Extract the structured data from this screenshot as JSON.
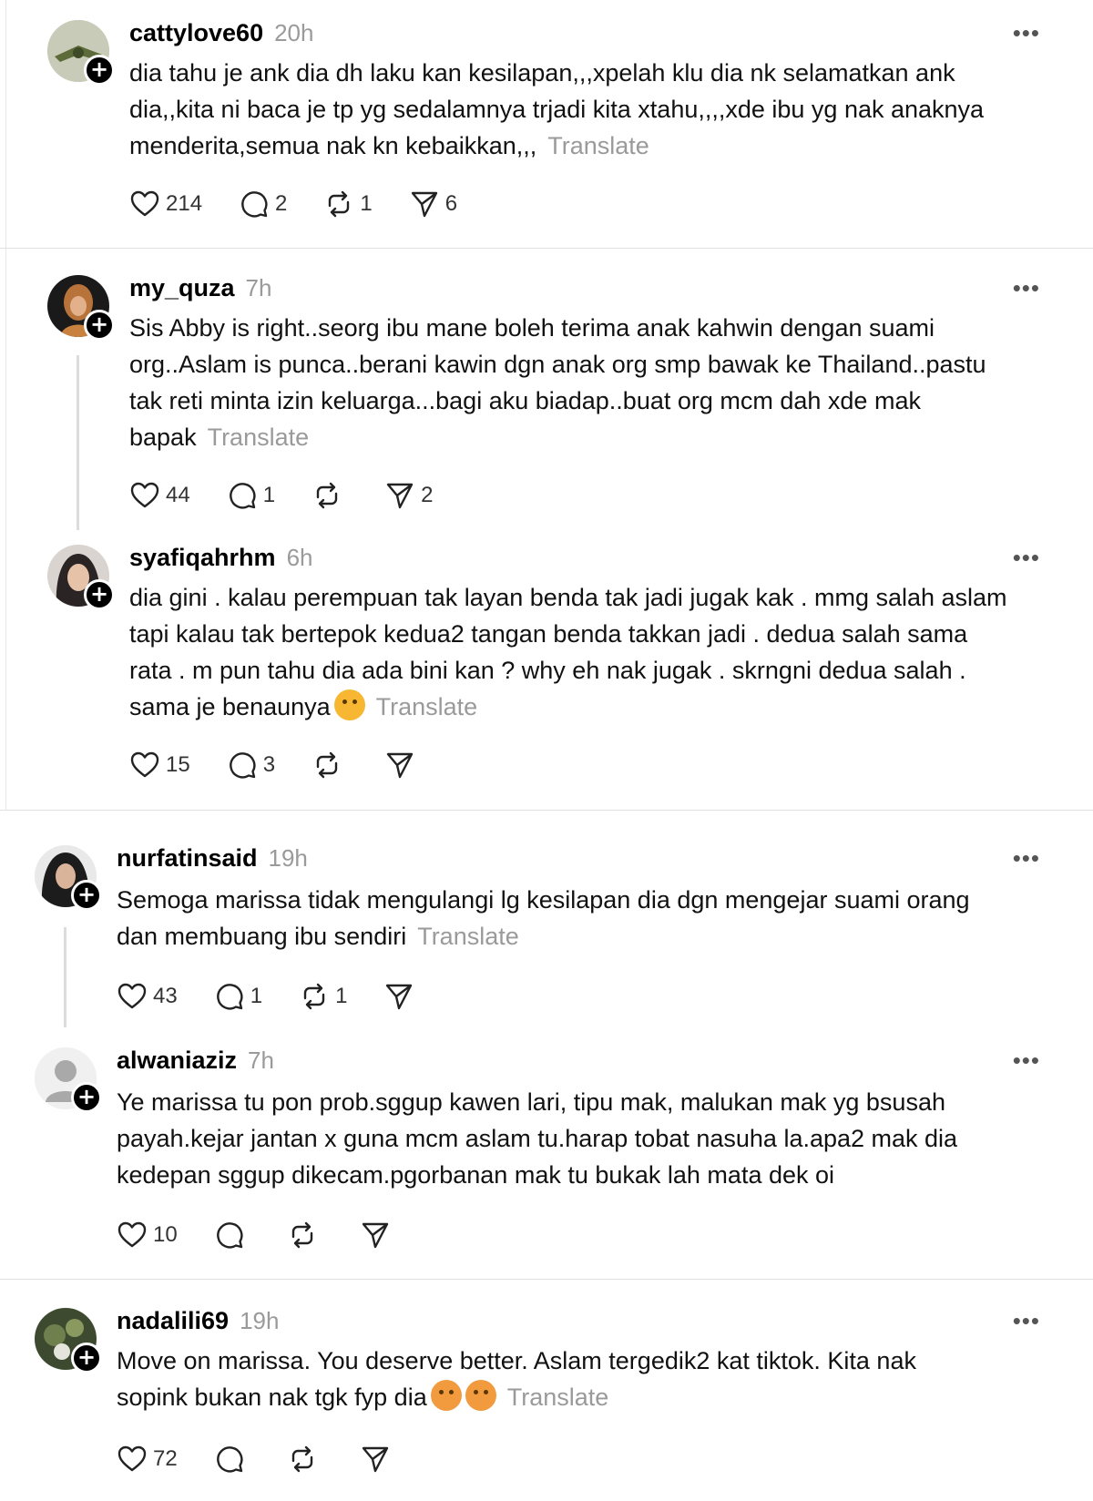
{
  "posts": [
    {
      "username": "cattylove60",
      "time": "20h",
      "text": "dia tahu je ank dia dh laku kan kesilapan,,,xpelah klu dia nk selamatkan ank\ndia,,kita ni baca je tp yg sedalamnya trjadi kita xtahu,,,,xde ibu yg nak anaknya\nmenderita,semua nak kn kebaikkan,,,",
      "translate": "Translate",
      "likes": "214",
      "replies": "2",
      "reposts": "1",
      "shares": "6"
    },
    {
      "username": "my_quza",
      "time": "7h",
      "text": "Sis Abby is right..seorg ibu mane boleh terima anak kahwin dengan suami\norg..Aslam is punca..berani kawin dgn anak org smp bawak ke Thailand..pastu\ntak reti minta izin keluarga...bagi aku biadap..buat org mcm dah xde mak\nbapak",
      "translate": "Translate",
      "likes": "44",
      "replies": "1",
      "reposts": "",
      "shares": "2"
    },
    {
      "username": "syafiqahrhm",
      "time": "6h",
      "text": "dia gini . kalau perempuan tak layan benda tak jadi jugak kak . mmg salah aslam\ntapi kalau tak bertepok kedua2 tangan benda takkan jadi . dedua salah sama\nrata . m pun tahu dia ada bini kan ? why eh nak jugak . skrngni dedua salah .\nsama je benaunya",
      "translate": "Translate",
      "likes": "15",
      "replies": "3",
      "reposts": "",
      "shares": ""
    },
    {
      "username": "nurfatinsaid",
      "time": "19h",
      "text": "Semoga marissa tidak mengulangi lg kesilapan dia dgn mengejar suami orang\ndan membuang ibu sendiri",
      "translate": "Translate",
      "likes": "43",
      "replies": "1",
      "reposts": "1",
      "shares": ""
    },
    {
      "username": "alwaniaziz",
      "time": "7h",
      "text": "Ye marissa tu pon prob.sggup kawen lari, tipu mak, malukan mak yg bsusah\npayah.kejar jantan x guna mcm aslam tu.harap tobat nasuha la.apa2 mak dia\nkedepan sggup dikecam.pgorbanan mak tu bukak lah mata dek oi",
      "translate": "",
      "likes": "10",
      "replies": "",
      "reposts": "",
      "shares": ""
    },
    {
      "username": "nadalili69",
      "time": "19h",
      "text": "Move on marissa. You deserve better. Aslam tergedik2 kat tiktok. Kita nak\nsopink bukan nak tgk fyp dia",
      "translate": "Translate",
      "likes": "72",
      "replies": "",
      "reposts": "",
      "shares": ""
    }
  ],
  "more_glyph": "•••",
  "follow_glyph": "+",
  "colors": {
    "muted": "#9a9a9a",
    "divider": "#e0e0e0",
    "thread": "#dcdcdc"
  },
  "icons": [
    "heart-icon",
    "comment-icon",
    "repost-icon",
    "send-icon",
    "more-icon",
    "follow-plus-icon"
  ]
}
